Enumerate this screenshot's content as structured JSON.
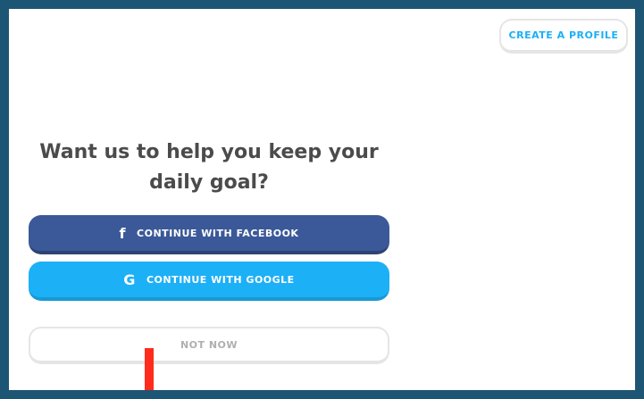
{
  "header": {
    "create_profile_label": "CREATE A PROFILE"
  },
  "main": {
    "title": "Want us to help you keep your daily goal?",
    "facebook_label": "CONTINUE WITH FACEBOOK",
    "facebook_icon": "f",
    "google_label": "CONTINUE WITH GOOGLE",
    "google_icon": "G",
    "not_now_label": "NOT NOW"
  },
  "colors": {
    "frame_border": "#1d5574",
    "facebook": "#3b5998",
    "google": "#1cb0f6",
    "title_text": "#4b4b4b",
    "secondary_text": "#afafaf",
    "marker": "#ff2b1c"
  }
}
